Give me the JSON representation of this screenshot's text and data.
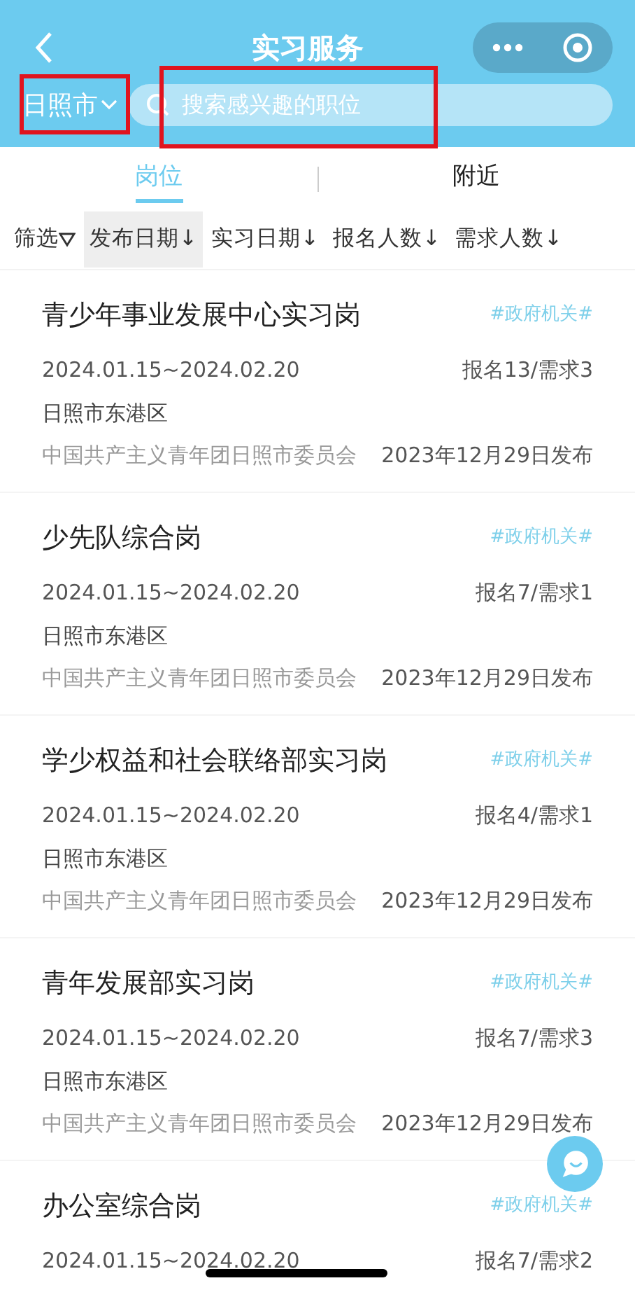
{
  "header": {
    "title": "实习服务",
    "city": "日照市",
    "search": {
      "placeholder": "搜索感兴趣的职位"
    }
  },
  "tabs": [
    {
      "label": "岗位",
      "selected": true
    },
    {
      "label": "附近",
      "selected": false
    }
  ],
  "sort_bar": [
    {
      "label": "筛选",
      "kind": "filter",
      "selected": false
    },
    {
      "label": "发布日期↓",
      "kind": "sort",
      "selected": true
    },
    {
      "label": "实习日期↓",
      "kind": "sort",
      "selected": false
    },
    {
      "label": "报名人数↓",
      "kind": "sort",
      "selected": false
    },
    {
      "label": "需求人数↓",
      "kind": "sort",
      "selected": false
    }
  ],
  "jobs": [
    {
      "title": "青少年事业发展中心实习岗",
      "tag": "#政府机关#",
      "dates": "2024.01.15~2024.02.20",
      "counts": "报名13/需求3",
      "location": "日照市东港区",
      "org": "中国共产主义青年团日照市委员会",
      "published": "2023年12月29日发布"
    },
    {
      "title": "少先队综合岗",
      "tag": "#政府机关#",
      "dates": "2024.01.15~2024.02.20",
      "counts": "报名7/需求1",
      "location": "日照市东港区",
      "org": "中国共产主义青年团日照市委员会",
      "published": "2023年12月29日发布"
    },
    {
      "title": "学少权益和社会联络部实习岗",
      "tag": "#政府机关#",
      "dates": "2024.01.15~2024.02.20",
      "counts": "报名4/需求1",
      "location": "日照市东港区",
      "org": "中国共产主义青年团日照市委员会",
      "published": "2023年12月29日发布"
    },
    {
      "title": "青年发展部实习岗",
      "tag": "#政府机关#",
      "dates": "2024.01.15~2024.02.20",
      "counts": "报名7/需求3",
      "location": "日照市东港区",
      "org": "中国共产主义青年团日照市委员会",
      "published": "2023年12月29日发布"
    },
    {
      "title": "办公室综合岗",
      "tag": "#政府机关#",
      "dates": "2024.01.15~2024.02.20",
      "counts": "报名7/需求2"
    }
  ]
}
